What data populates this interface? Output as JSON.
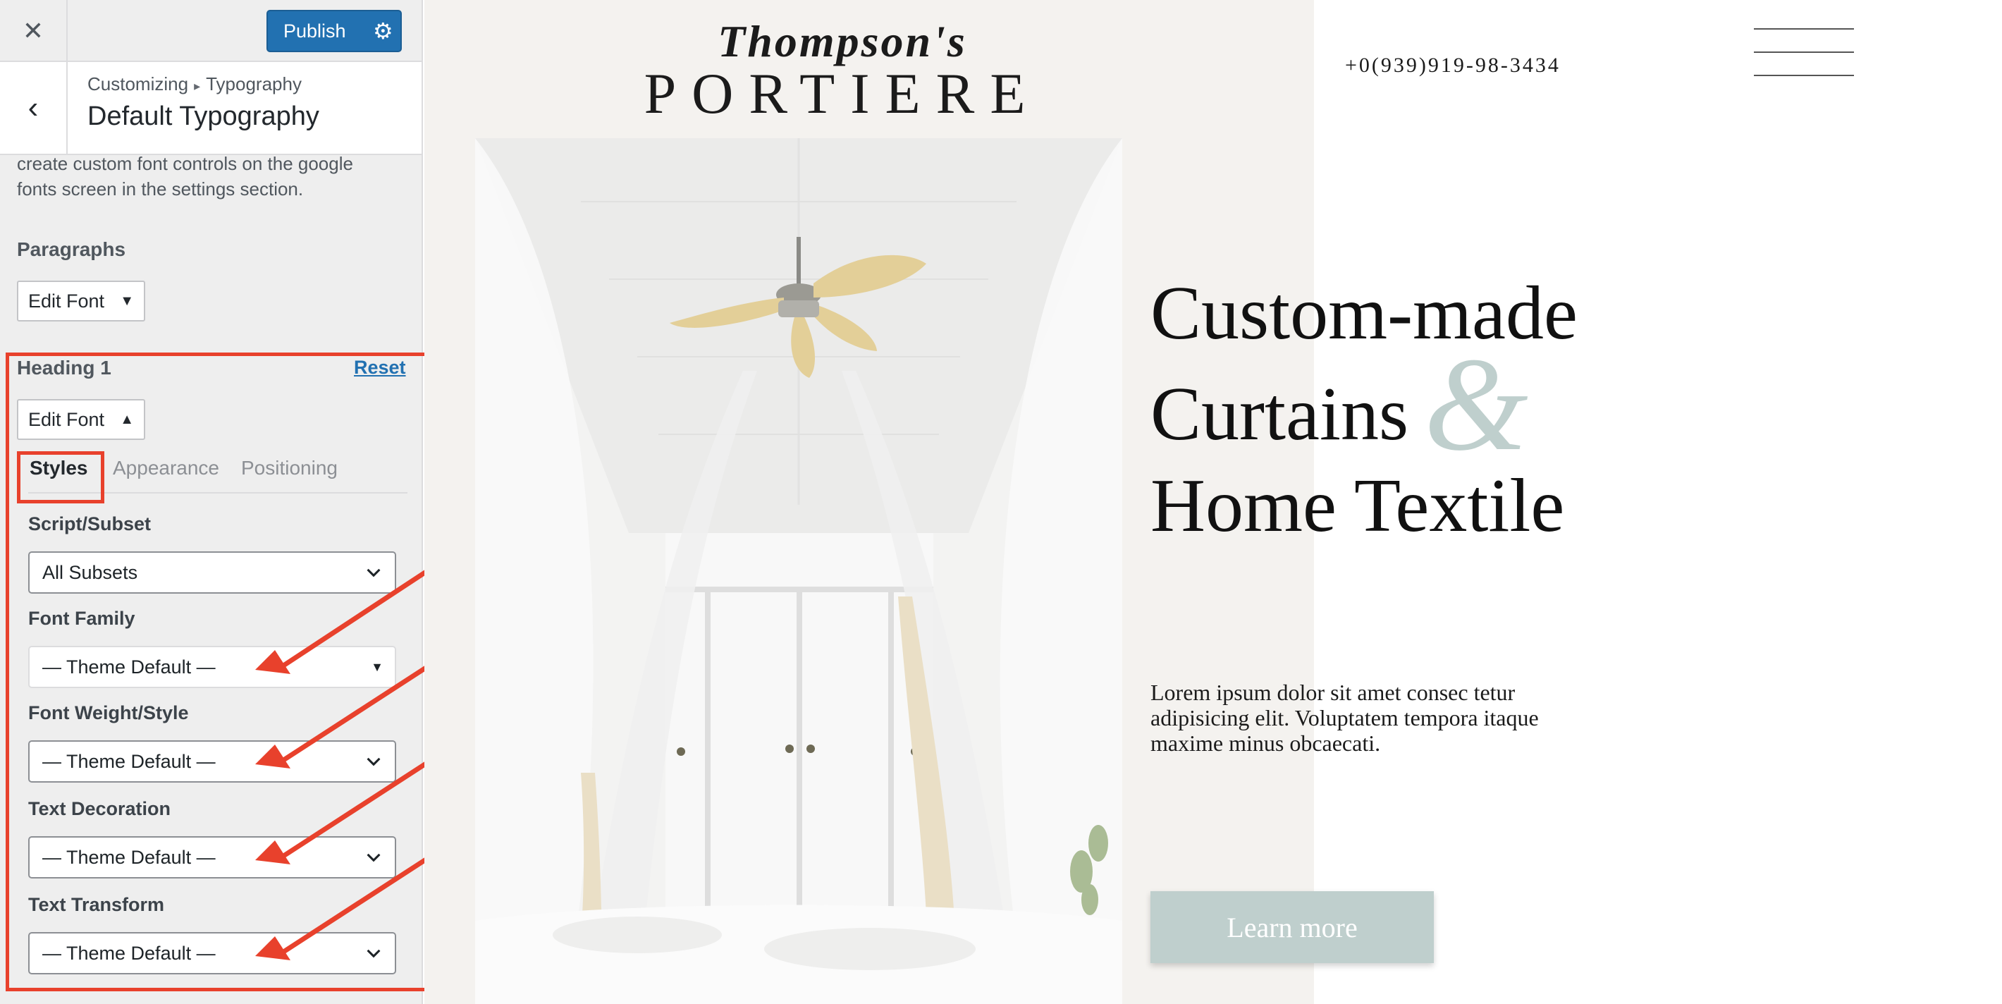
{
  "header": {
    "close_icon": "close-icon",
    "publish_label": "Publish",
    "settings_icon": "gear-icon"
  },
  "section": {
    "breadcrumb_parent": "Customizing",
    "breadcrumb_sep": "▸",
    "breadcrumb_child": "Typography",
    "title": "Default Typography",
    "back_icon": "chevron-left-icon"
  },
  "description": "create custom font controls on the google fonts screen in the settings section.",
  "paragraphs": {
    "title": "Paragraphs",
    "edit_label": "Edit Font",
    "caret": "▼"
  },
  "heading1": {
    "title": "Heading 1",
    "reset_label": "Reset",
    "edit_label": "Edit Font",
    "caret": "▲",
    "tabs": [
      {
        "label": "Styles",
        "active": true
      },
      {
        "label": "Appearance",
        "active": false
      },
      {
        "label": "Positioning",
        "active": false
      }
    ],
    "fields": [
      {
        "label": "Script/Subset",
        "value": "All Subsets"
      },
      {
        "label": "Font Family",
        "value": "— Theme Default —"
      },
      {
        "label": "Font Weight/Style",
        "value": "— Theme Default —"
      },
      {
        "label": "Text Decoration",
        "value": "— Theme Default —"
      },
      {
        "label": "Text Transform",
        "value": "— Theme Default —"
      }
    ],
    "font_family_caret": "▼"
  },
  "annotation_color": "#e8412c",
  "site": {
    "logo_script": "Thompson's",
    "logo_main": "PORTIERE",
    "phone": "+0(939)919-98-3434",
    "hero_line1": "Custom-made",
    "hero_line2": "Curtains",
    "hero_amp": "&",
    "hero_line3": "Home Textile",
    "hero_text": "Lorem ipsum dolor sit amet consec tetur adipisicing elit. Voluptatem tempora itaque maxime minus obcaecati.",
    "cta_label": "Learn more",
    "accent": "#bfcfcd",
    "background": "#f4f2ef"
  }
}
